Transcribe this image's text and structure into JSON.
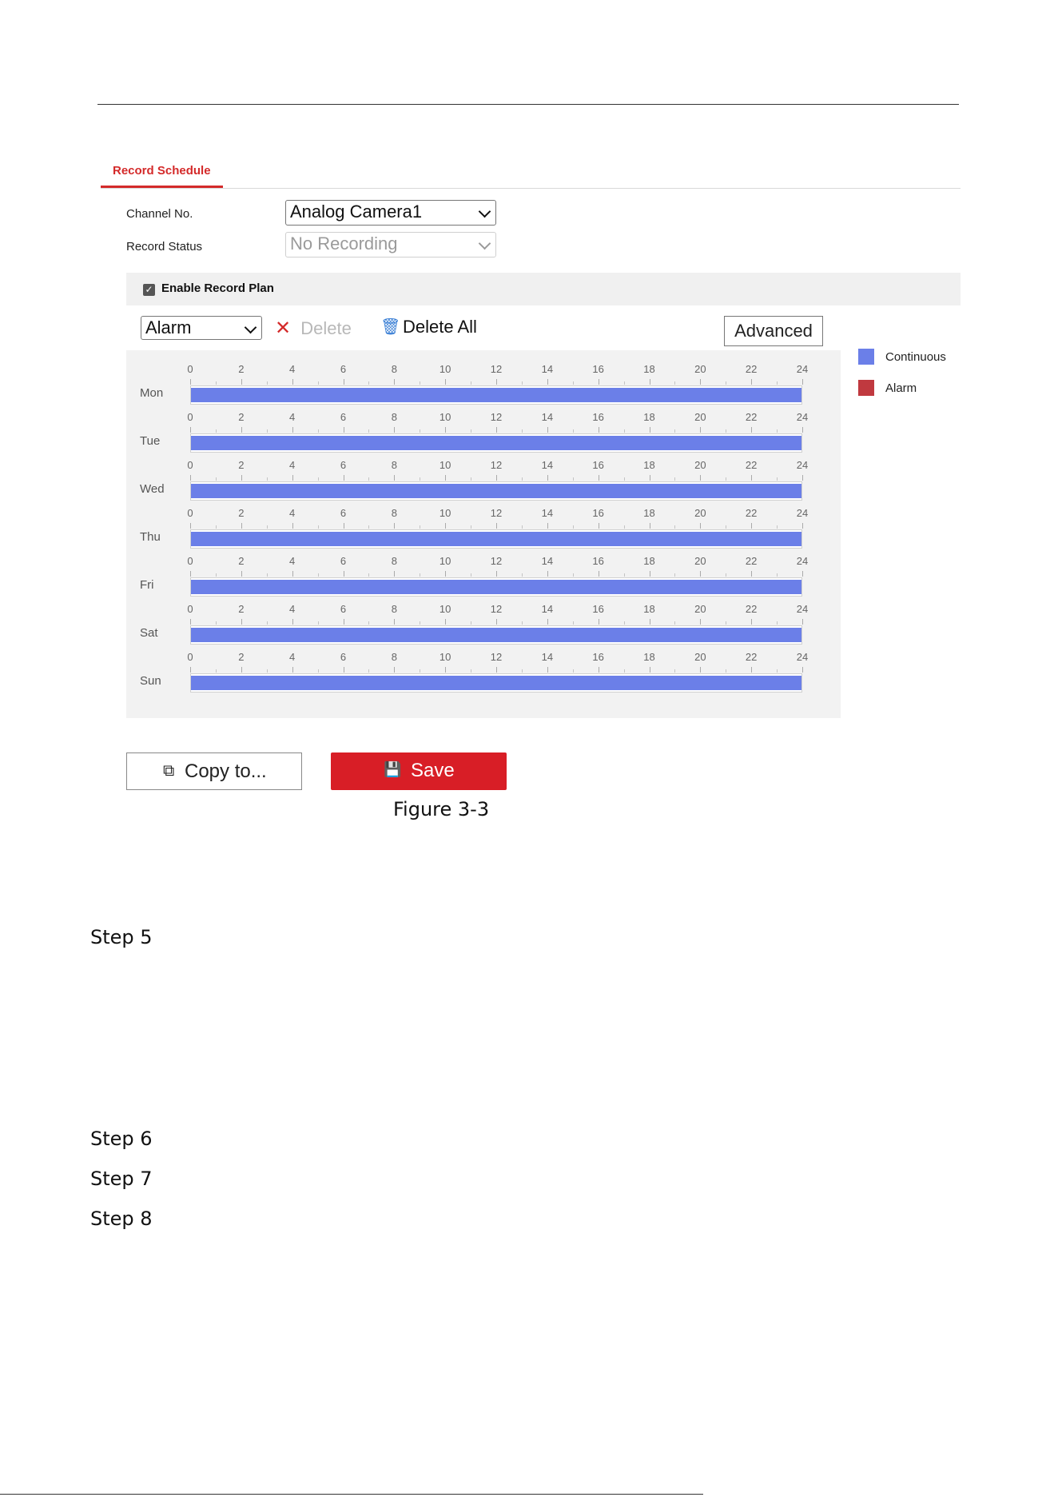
{
  "tab": {
    "label": "Record Schedule"
  },
  "form": {
    "channel_label": "Channel No.",
    "channel_value": "Analog Camera1",
    "status_label": "Record Status",
    "status_value": "No Recording"
  },
  "enable": {
    "label": "Enable Record Plan",
    "checked": true,
    "check_glyph": "✓"
  },
  "toolbar": {
    "type_value": "Alarm",
    "delete_label": "Delete",
    "delete_glyph": "✕",
    "delete_all_label": "Delete All",
    "trash_glyph": "🗑",
    "advanced_label": "Advanced"
  },
  "schedule": {
    "hour_ticks": [
      "0",
      "2",
      "4",
      "6",
      "8",
      "10",
      "12",
      "14",
      "16",
      "18",
      "20",
      "22",
      "24"
    ],
    "days": [
      {
        "label": "Mon",
        "segments": [
          {
            "start": 0,
            "end": 24,
            "type": "Continuous"
          }
        ]
      },
      {
        "label": "Tue",
        "segments": [
          {
            "start": 0,
            "end": 24,
            "type": "Continuous"
          }
        ]
      },
      {
        "label": "Wed",
        "segments": [
          {
            "start": 0,
            "end": 24,
            "type": "Continuous"
          }
        ]
      },
      {
        "label": "Thu",
        "segments": [
          {
            "start": 0,
            "end": 24,
            "type": "Continuous"
          }
        ]
      },
      {
        "label": "Fri",
        "segments": [
          {
            "start": 0,
            "end": 24,
            "type": "Continuous"
          }
        ]
      },
      {
        "label": "Sat",
        "segments": [
          {
            "start": 0,
            "end": 24,
            "type": "Continuous"
          }
        ]
      },
      {
        "label": "Sun",
        "segments": [
          {
            "start": 0,
            "end": 24,
            "type": "Continuous"
          }
        ]
      }
    ]
  },
  "legend": [
    {
      "label": "Continuous",
      "color": "#6b7fe8"
    },
    {
      "label": "Alarm",
      "color": "#c0393f"
    }
  ],
  "buttons": {
    "copy_label": "Copy to...",
    "copy_glyph": "⧉",
    "save_label": "Save",
    "save_glyph": "💾",
    "save_color": "#d81e26"
  },
  "caption": "Figure 3-3",
  "steps": [
    "Step 5",
    "Step 6",
    "Step 7",
    "Step 8"
  ]
}
